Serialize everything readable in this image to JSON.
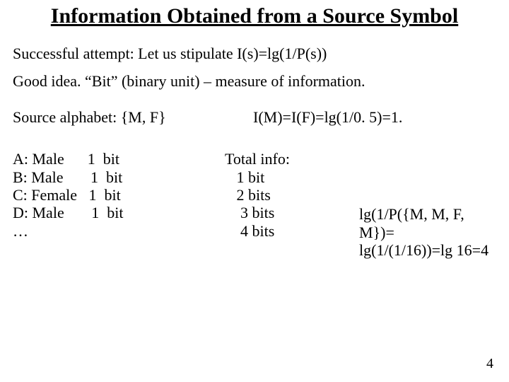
{
  "title": "Information Obtained from a Source Symbol",
  "line1": "Successful attempt: Let us stipulate I(s)=lg(1/P(s))",
  "line2": "Good idea. “Bit” (binary unit) – measure of information.",
  "alphabet_label": "Source alphabet: {M, F}",
  "im_if_line": "I(M)=I(F)=lg(1/0. 5)=1.",
  "people": {
    "a": "A: Male      1  bit",
    "b": "B: Male       1  bit",
    "c": "C: Female   1  bit",
    "d": "D: Male       1  bit",
    "ellipsis": "…"
  },
  "totals": {
    "heading": "Total info:",
    "t1": "   1 bit",
    "t2": "   2 bits",
    "t3": "    3 bits",
    "t4": "    4 bits"
  },
  "formula": {
    "l1": "lg(1/P({M, M, F, M})=",
    "l2": "lg(1/(1/16))=lg 16=4"
  },
  "page_number": "4"
}
